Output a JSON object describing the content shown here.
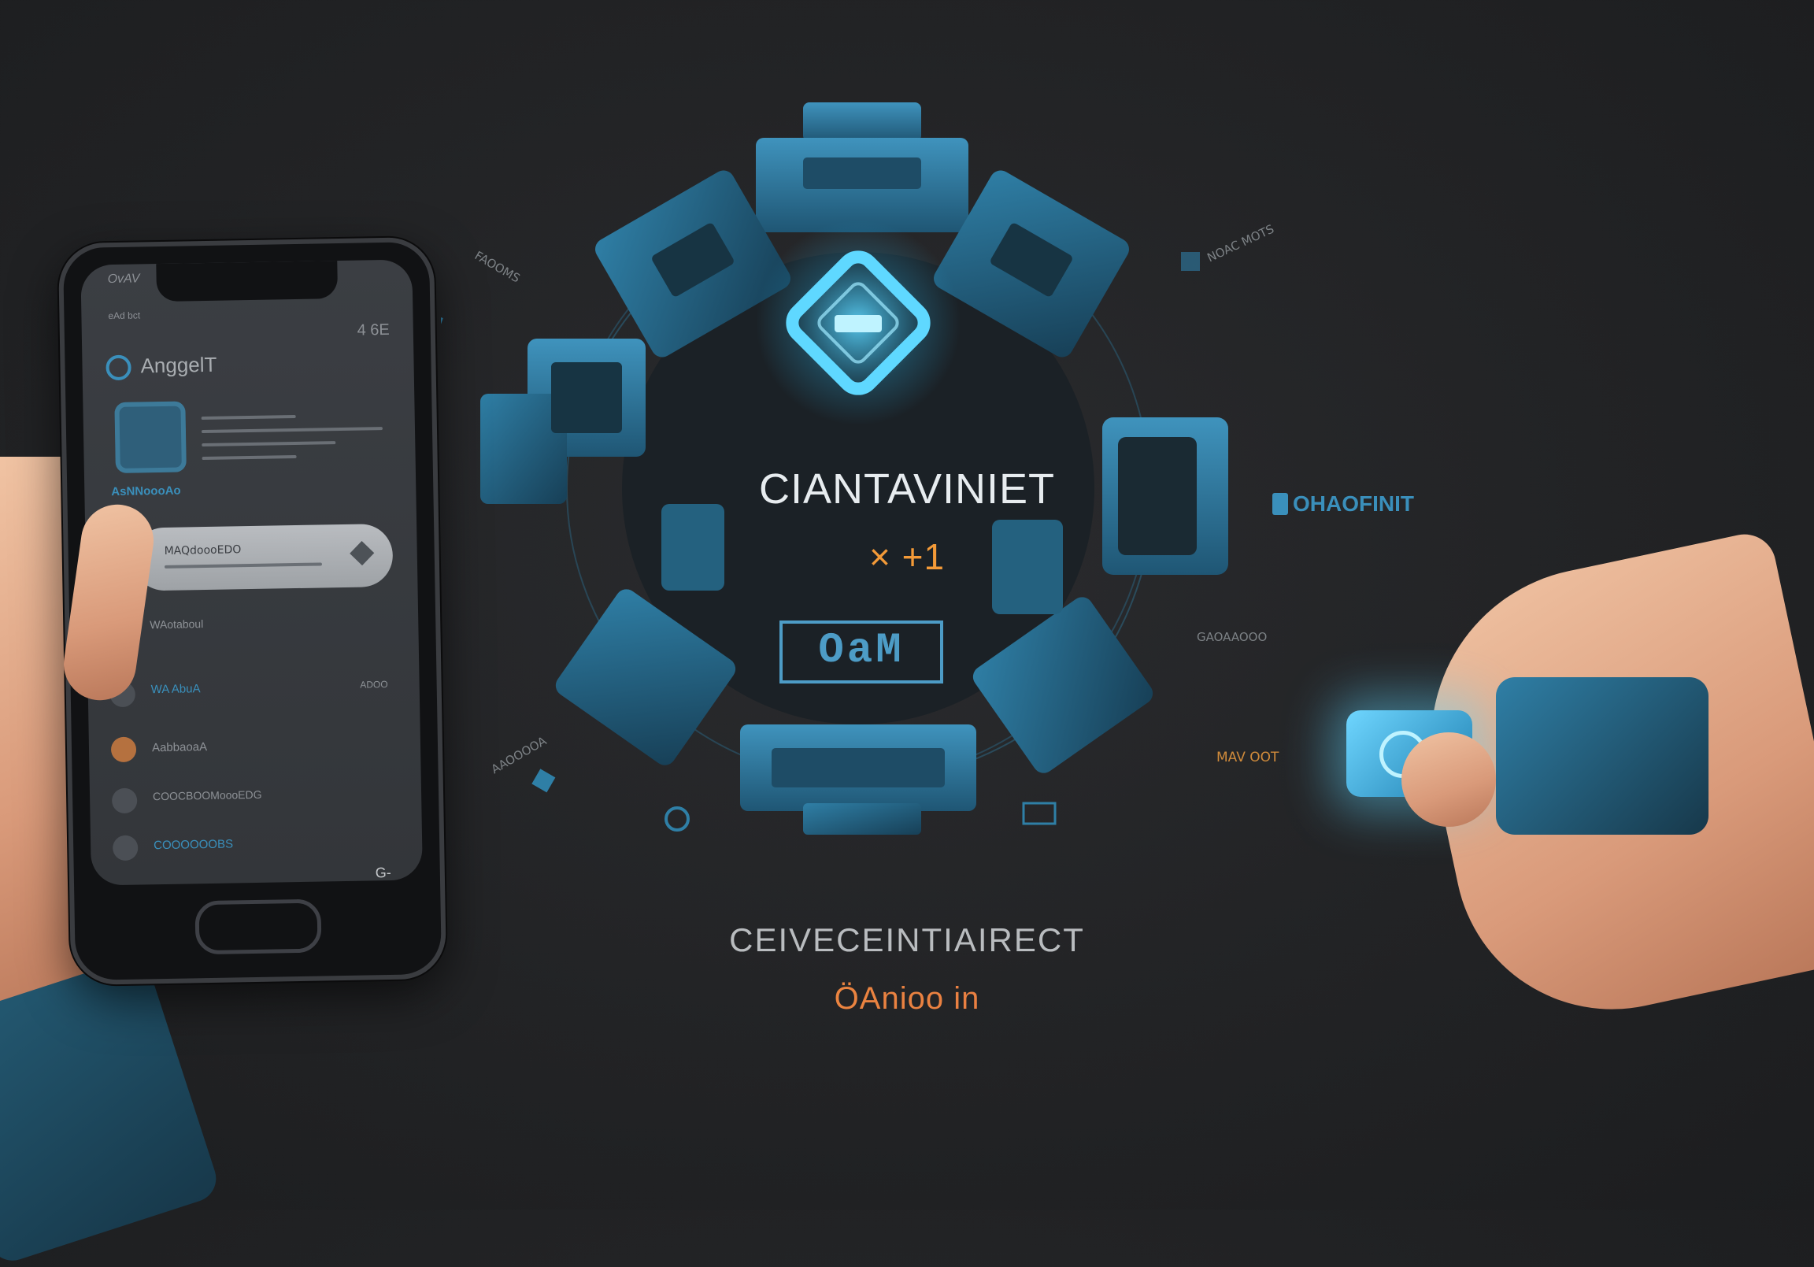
{
  "ring": {
    "title": "CIANTAVINIET",
    "subtitle": "× +1",
    "badge": "OaM"
  },
  "phone": {
    "status": "OvAV",
    "status_small": "eAd bct",
    "clock": "4 6E",
    "app_name": "AnggelT",
    "section_label": "AsNNoooAo",
    "pill_text": "MAQdoooEDO",
    "row_label_1": "WAotaboul",
    "row_label_2": "WA AbuA",
    "row_meta_2": "ADOO",
    "row_label_3": "AabbaoaA",
    "row_label_4": "COOCBOOMoooEDG",
    "row_label_5": "COOOOOOBS",
    "footer_icon": "G-"
  },
  "side": {
    "right_label": "OHAOFINIT",
    "right_small_1": "NOAC MOTS",
    "right_small_2": "GAOAAOOO",
    "right_small_3": "MAV OOT",
    "left_small_1": "FAOOMS",
    "left_small_2": "AAOOOOA"
  },
  "footer": {
    "headline": "CEIVECEINTIAIRECT",
    "brand": "ÖAnioo in"
  },
  "colors": {
    "background": "#232426",
    "accent_blue": "#2f7fa6",
    "glow": "#5fd8ff",
    "orange": "#f39a38"
  }
}
